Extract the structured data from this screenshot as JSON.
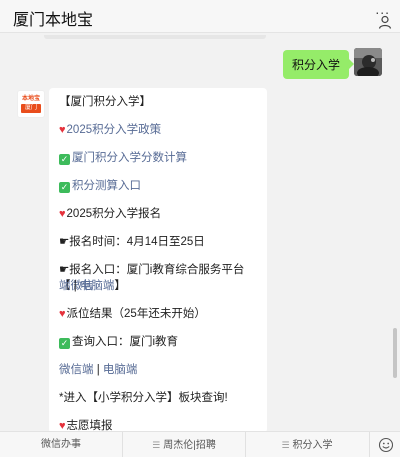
{
  "header": {
    "title": "厦门本地宝",
    "more": "..."
  },
  "outgoing": {
    "text": "积分入学"
  },
  "bot_avatar": {
    "logo_top": "本地宝",
    "logo_bottom": "厦门"
  },
  "message": {
    "line1": "【厦门积分入学】",
    "line2": "2025积分入学政策",
    "line3": "厦门积分入学分数计算",
    "line4": "积分测算入口",
    "line5": "2025积分入学报名",
    "line6": "☛报名时间：4月14日至25日",
    "line7_prefix": "☛报名入口：厦门i教育综合服务平台【",
    "line7_link1": "微信",
    "line8_link1": "端",
    "line8_sep": " | ",
    "line8_link2": "电脑端",
    "line8_suffix": "】",
    "line9": "派位结果（25年还未开始）",
    "line10": "查询入口：厦门i教育",
    "line11_link1": "微信端",
    "line11_sep": " | ",
    "line11_link2": "电脑端",
    "line12": "*进入【小学积分入学】板块查询!",
    "line13": "志愿填报"
  },
  "bottom_menu": {
    "item1": "微信办事",
    "item2": "周杰伦|招聘",
    "item3": "积分入学"
  },
  "colors": {
    "out_bubble": "#95ec69",
    "link": "#576b95",
    "heart": "#e5323c",
    "check": "#3dbb5b",
    "brand": "#e94d1c"
  }
}
